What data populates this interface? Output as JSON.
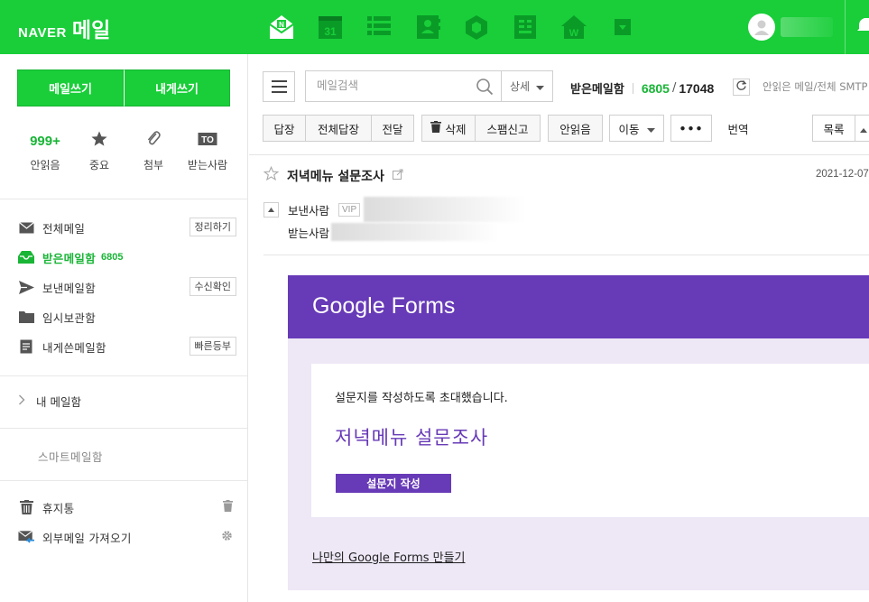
{
  "topbar": {
    "brand": "NAVER",
    "service": "메일",
    "apps": [
      {
        "name": "mail-app-icon"
      },
      {
        "name": "calendar-app-icon",
        "text": "31"
      },
      {
        "name": "contacts-app-icon"
      },
      {
        "name": "address-book-app-icon"
      },
      {
        "name": "mybox-app-icon"
      },
      {
        "name": "memo-app-icon"
      },
      {
        "name": "blog-app-icon",
        "text": "W"
      },
      {
        "name": "more-apps-icon"
      }
    ]
  },
  "sidebar": {
    "write_mail": "메일쓰기",
    "write_self": "내게쓰기",
    "quick": [
      {
        "label": "안읽음",
        "count": "999+"
      },
      {
        "label": "중요",
        "icon": "star-icon"
      },
      {
        "label": "첨부",
        "icon": "clip-icon"
      },
      {
        "label": "받는사람",
        "icon": "to-icon",
        "badge": "TO"
      }
    ],
    "folders": [
      {
        "label": "전체메일",
        "button": "정리하기"
      },
      {
        "label": "받은메일함",
        "count": "6805"
      },
      {
        "label": "보낸메일함",
        "button": "수신확인"
      },
      {
        "label": "임시보관함"
      },
      {
        "label": "내게쓴메일함",
        "button": "빠른등부"
      }
    ],
    "my_mailbox": "내 메일함",
    "smart_mailbox": "스마트메일함",
    "trash": "휴지통",
    "external": "외부메일 가져오기"
  },
  "toolbar": {
    "search_placeholder": "메일검색",
    "detail": "상세",
    "inbox_label": "받은메일함",
    "unread": "6805",
    "slash": "/",
    "total": "17048",
    "note": "안읽은 메일/전체 SMTP 가능",
    "buttons": {
      "reply": "답장",
      "reply_all": "전체답장",
      "forward": "전달",
      "delete": "삭제",
      "spam": "스팸신고",
      "unread": "안읽음",
      "move": "이동",
      "more": "•••",
      "translate": "번역",
      "list": "목록"
    }
  },
  "mail": {
    "subject": "저녁메뉴 설문조사",
    "date": "2021-12-07",
    "from_label": "보낸사람",
    "vip": "VIP",
    "to_label": "받는사람"
  },
  "gforms": {
    "logo_google": "Google",
    "logo_forms": "Forms",
    "invite": "설문지를 작성하도록 초대했습니다.",
    "form_title": "저녁메뉴 설문조사",
    "button": "설문지 작성",
    "link": "나만의 Google Forms 만들기"
  },
  "colors": {
    "brand": "#19ce39",
    "forms_purple": "#673ab7",
    "forms_bg": "#ede7f6"
  }
}
